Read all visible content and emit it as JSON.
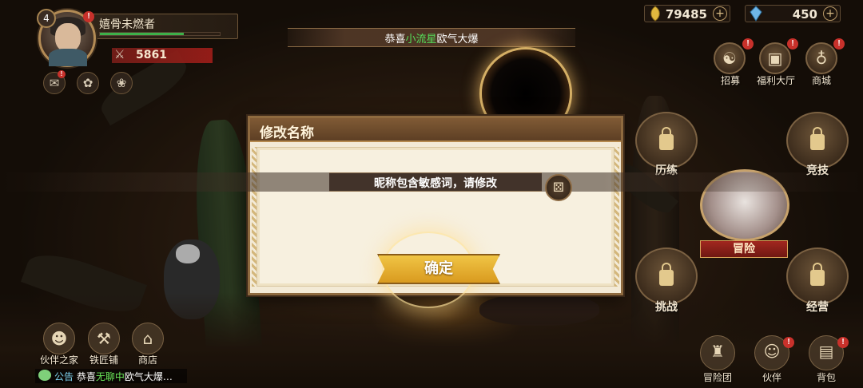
{
  "player": {
    "level": "4",
    "name": "嬉骨未燃者",
    "power": "5861",
    "xp_fraction": 0.7
  },
  "currency": {
    "gold": "79485",
    "diamond": "450"
  },
  "announcement": {
    "prefix": "恭喜",
    "name": "小流星",
    "suffix": "欧气大爆"
  },
  "right_menu": {
    "recruit": "招募",
    "welfare": "福利大厅",
    "mall": "商城",
    "training": "历练",
    "arena": "竞技",
    "adventure": "冒险",
    "challenge": "挑战",
    "manage": "经营"
  },
  "bottom_left": {
    "partner_home": "伙伴之家",
    "blacksmith": "铁匠铺",
    "shop": "商店"
  },
  "bottom_right": {
    "guild": "冒险团",
    "partner": "伙伴",
    "bag": "背包"
  },
  "chat": {
    "tag": "公告",
    "prefix": "恭喜",
    "name": "无聊中",
    "suffix": "欧气大爆…"
  },
  "dialog": {
    "title": "修改名称",
    "confirm": "确定"
  },
  "toast": {
    "message": "昵称包含敏感词，请修改"
  },
  "colors": {
    "highlight_green": "#55e05a",
    "badge_red": "#c8312b",
    "confirm_gold": "#f0c545"
  }
}
